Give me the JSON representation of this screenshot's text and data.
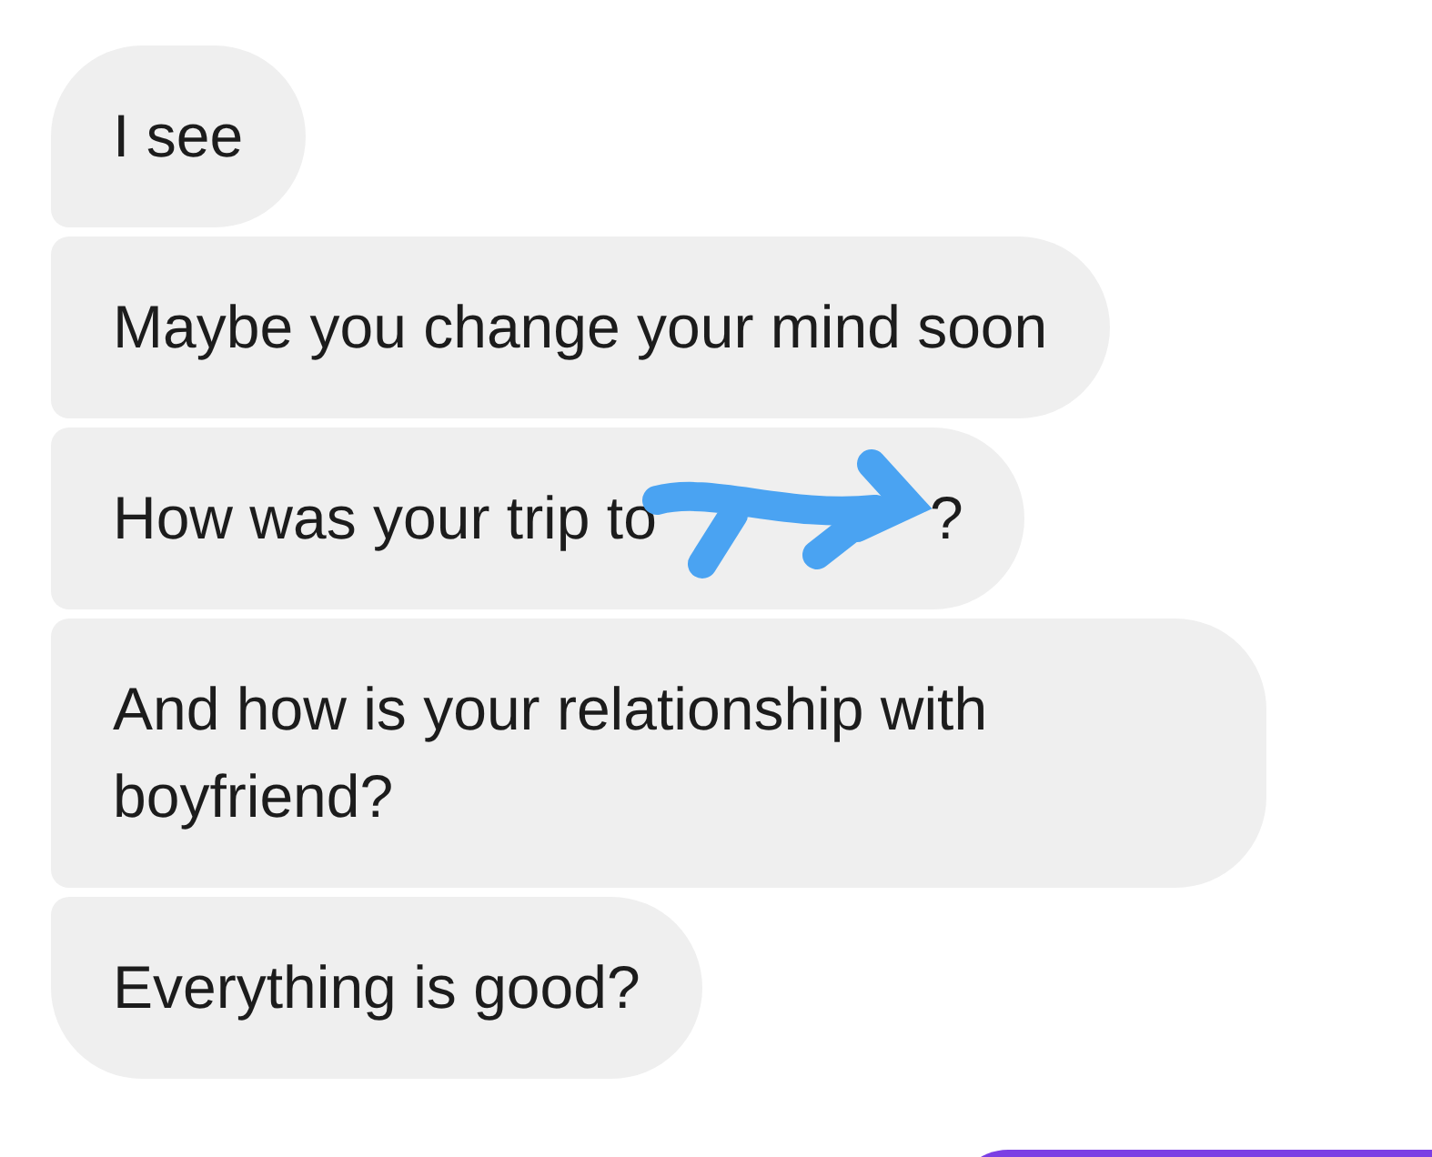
{
  "messages": [
    {
      "kind": "incoming",
      "text": "I see"
    },
    {
      "kind": "incoming",
      "text": "Maybe you change your mind soon"
    },
    {
      "kind": "incoming",
      "text": "How was your trip to",
      "redacted": true,
      "text_after": "?"
    },
    {
      "kind": "incoming",
      "text": "And how is your relationship with boyfriend?"
    },
    {
      "kind": "incoming",
      "text": "Everything is good?"
    },
    {
      "kind": "outgoing"
    }
  ]
}
